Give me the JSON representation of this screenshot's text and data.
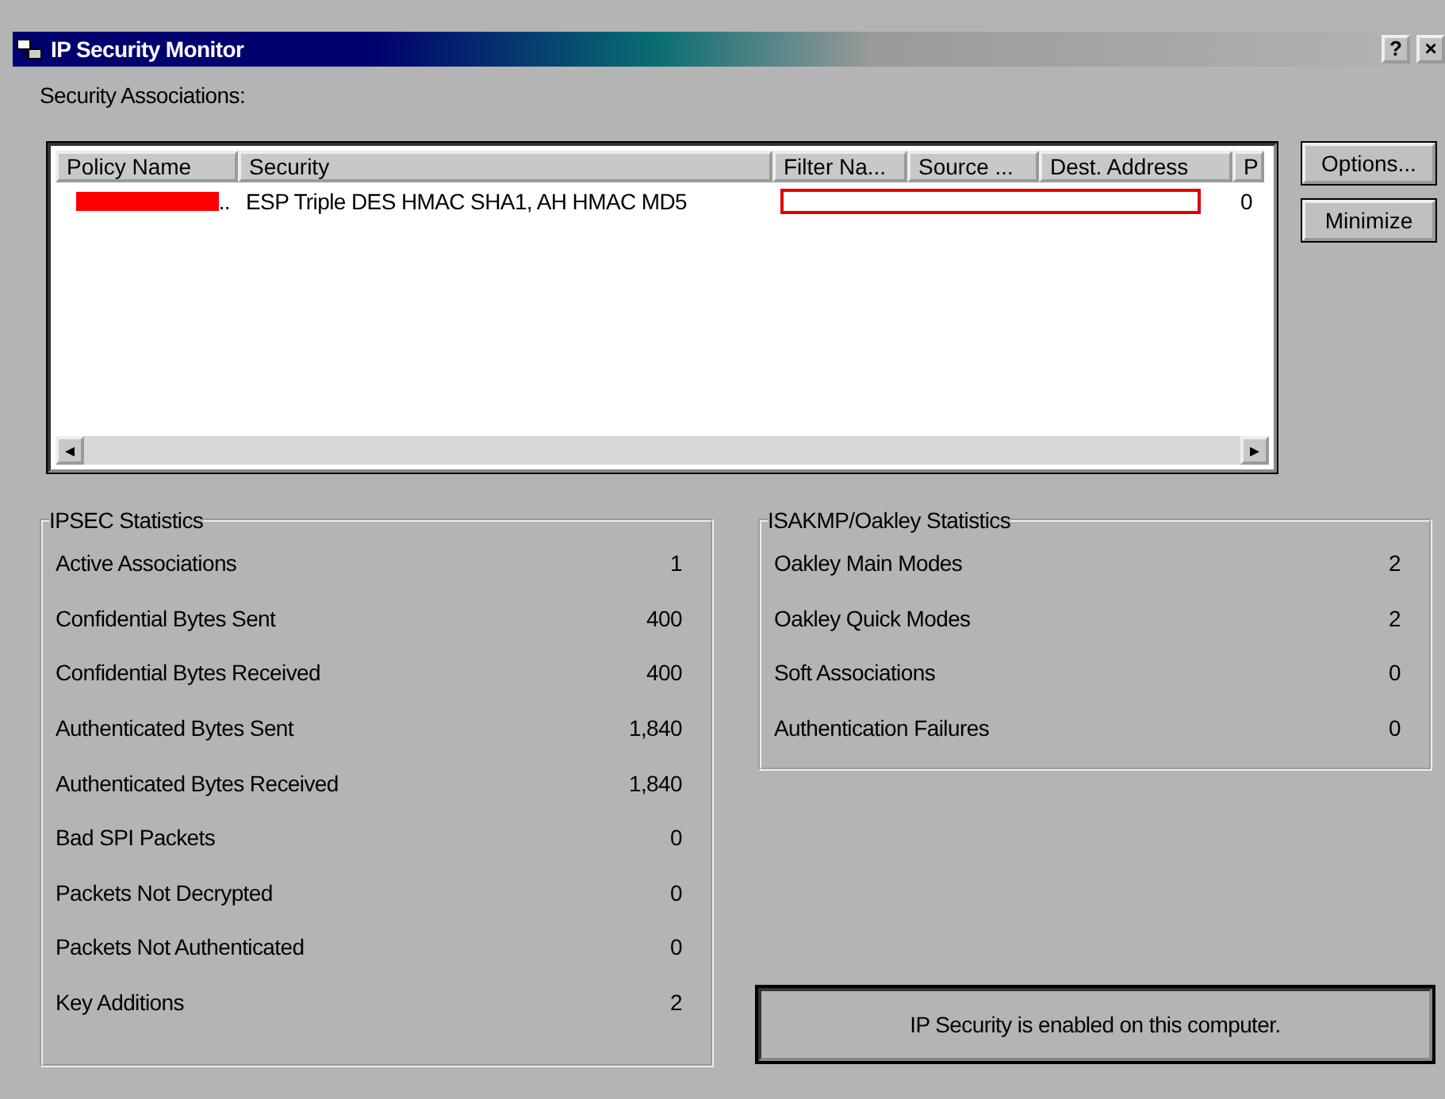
{
  "window": {
    "title": "IP Security Monitor",
    "help_button": "?",
    "close_button": "×"
  },
  "associations": {
    "label": "Security Associations:",
    "columns": [
      "Policy Name",
      "Security",
      "Filter Na...",
      "Source ...",
      "Dest. Address",
      "P"
    ],
    "rows": [
      {
        "policy_name": "..",
        "redacted_policy": true,
        "security": "ESP Triple DES HMAC SHA1, AH HMAC MD5",
        "redacted_filter": true,
        "column_6": "0"
      }
    ],
    "scroll_left": "◂",
    "scroll_right": "▸"
  },
  "buttons": [
    "Options...",
    "Minimize"
  ],
  "ipsec_statistics": {
    "title": "IPSEC Statistics",
    "rows": [
      {
        "label": "Active Associations",
        "value": "1"
      },
      {
        "label": "Confidential Bytes Sent",
        "value": "400"
      },
      {
        "label": "Confidential Bytes Received",
        "value": "400"
      },
      {
        "label": "Authenticated Bytes Sent",
        "value": "1,840"
      },
      {
        "label": "Authenticated Bytes Received",
        "value": "1,840"
      },
      {
        "label": "Bad SPI Packets",
        "value": "0"
      },
      {
        "label": "Packets Not Decrypted",
        "value": "0"
      },
      {
        "label": "Packets Not Authenticated",
        "value": "0"
      },
      {
        "label": "Key Additions",
        "value": "2"
      }
    ]
  },
  "isakmp_statistics": {
    "title": "ISAKMP/Oakley Statistics",
    "rows": [
      {
        "label": "Oakley Main Modes",
        "value": "2"
      },
      {
        "label": "Oakley Quick Modes",
        "value": "2"
      },
      {
        "label": "Soft Associations",
        "value": "0"
      },
      {
        "label": "Authentication Failures",
        "value": "0"
      }
    ]
  },
  "status": "IP Security is enabled on this computer."
}
